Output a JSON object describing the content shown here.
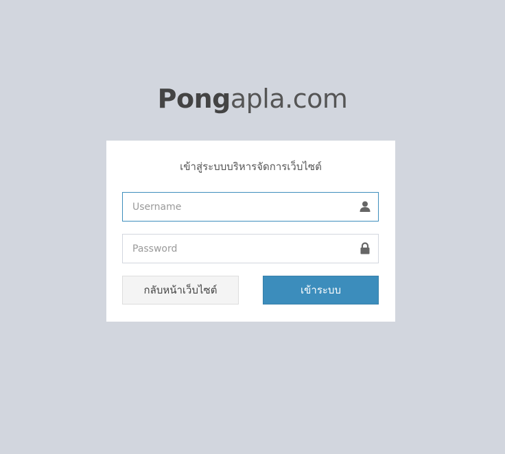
{
  "logo": {
    "bold": "Pong",
    "light": "apla.com"
  },
  "login_box": {
    "title": "เข้าสู่ระบบบริหารจัดการเว็บไซต์",
    "username_placeholder": "Username",
    "username_value": "",
    "password_placeholder": "Password",
    "password_value": "",
    "back_button_label": "กลับหน้าเว็บไซต์",
    "login_button_label": "เข้าระบบ"
  },
  "icons": {
    "username": "user-icon",
    "password": "lock-icon"
  },
  "colors": {
    "background": "#d2d6de",
    "primary": "#3c8dbc",
    "card": "#ffffff",
    "back_button": "#f4f4f4"
  }
}
